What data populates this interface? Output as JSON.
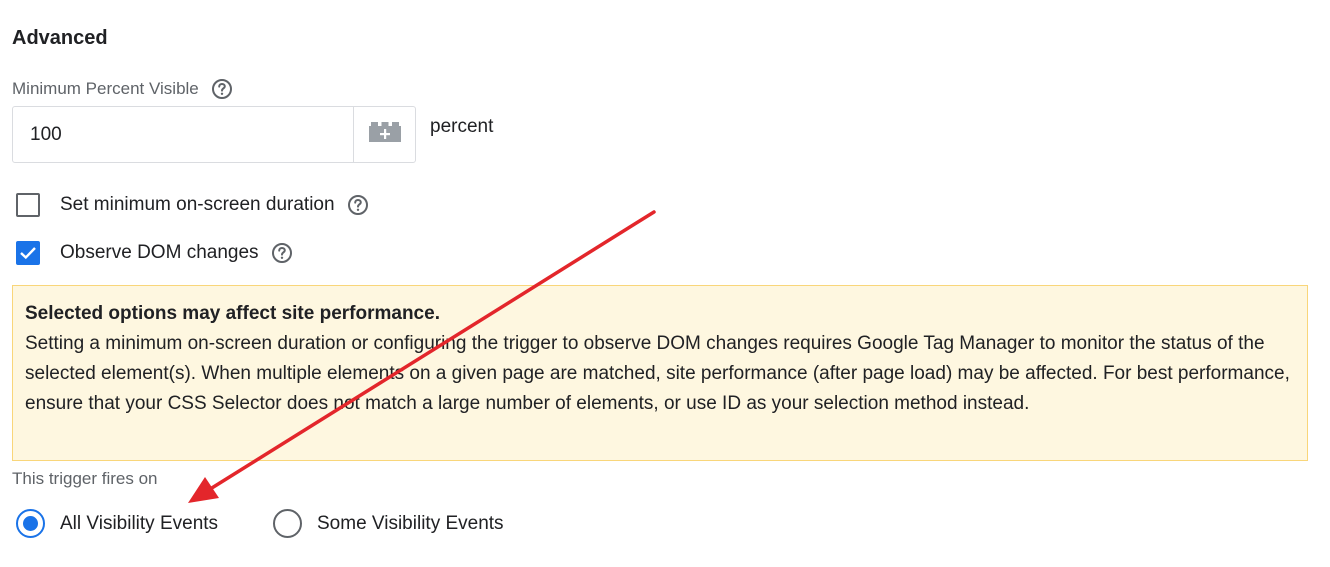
{
  "section": {
    "title": "Advanced"
  },
  "min_percent": {
    "label": "Minimum Percent Visible",
    "value": "100",
    "unit": "percent",
    "variable_button_icon": "variable-lego-icon"
  },
  "options": {
    "duration_label": "Set minimum on-screen duration",
    "duration_checked": false,
    "dom_label": "Observe DOM changes",
    "dom_checked": true
  },
  "warning": {
    "title": "Selected options may affect site performance.",
    "body": "Setting a minimum on-screen duration or configuring the trigger to observe DOM changes requires Google Tag Manager to monitor the status of the selected element(s). When multiple elements on a given page are matched, site performance (after page load) may be affected. For best performance, ensure that your CSS Selector does not match a large number of elements, or use ID as your selection method instead."
  },
  "fires_on": {
    "label": "This trigger fires on",
    "option_all": "All Visibility Events",
    "option_some": "Some Visibility Events",
    "selected": "all"
  },
  "colors": {
    "accent": "#1a73e8",
    "warning_bg": "#fef7e0",
    "warning_border": "#f9d67a",
    "annotation_arrow": "#e3262b"
  }
}
